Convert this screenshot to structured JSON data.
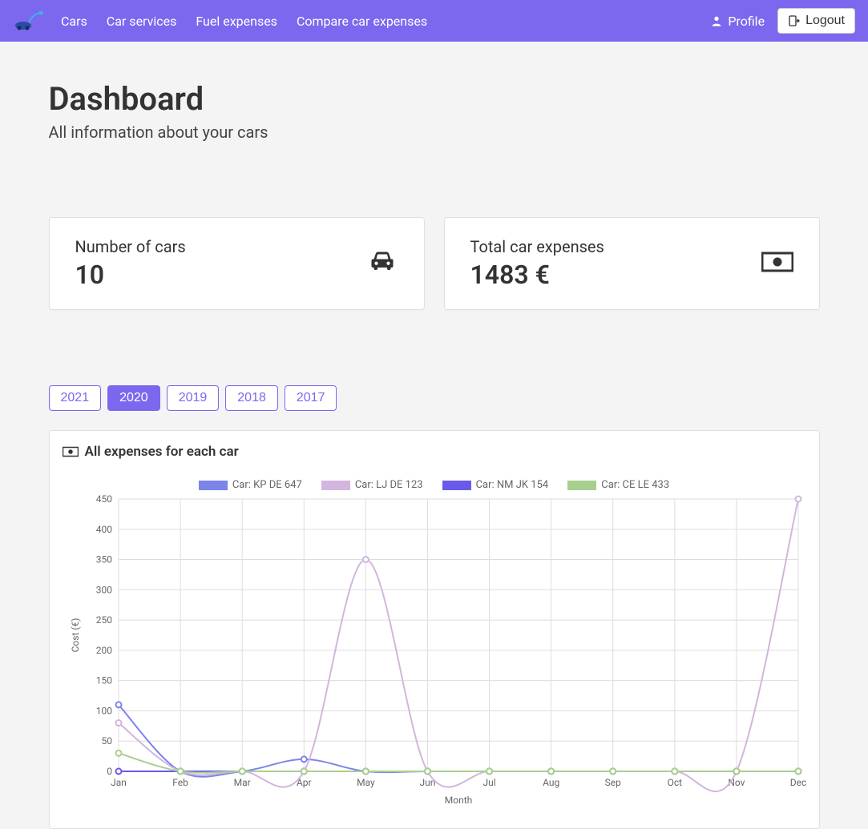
{
  "nav": {
    "links": [
      "Cars",
      "Car services",
      "Fuel expenses",
      "Compare car expenses"
    ],
    "profile": "Profile",
    "logout": "Logout"
  },
  "header": {
    "title": "Dashboard",
    "subtitle": "All information about your cars"
  },
  "cards": {
    "num_cars": {
      "label": "Number of cars",
      "value": "10"
    },
    "total_expenses": {
      "label": "Total car expenses",
      "value": "1483 €"
    }
  },
  "years": [
    "2021",
    "2020",
    "2019",
    "2018",
    "2017"
  ],
  "active_year": "2020",
  "chart_title": "All expenses for each car",
  "chart_data": {
    "type": "line",
    "title": "All expenses for each car",
    "xlabel": "Month",
    "ylabel": "Cost (€)",
    "categories": [
      "Jan",
      "Feb",
      "Mar",
      "Apr",
      "May",
      "Jun",
      "Jul",
      "Aug",
      "Sep",
      "Oct",
      "Nov",
      "Dec"
    ],
    "ylim": [
      0,
      450
    ],
    "yticks": [
      0,
      50,
      100,
      150,
      200,
      250,
      300,
      350,
      400,
      450
    ],
    "series": [
      {
        "name": "Car: KP DE 647",
        "color": "#7b85e9",
        "values": [
          110,
          0,
          0,
          20,
          0,
          0,
          0,
          0,
          0,
          0,
          0,
          0
        ]
      },
      {
        "name": "Car: LJ DE 123",
        "color": "#d3b5de",
        "values": [
          80,
          0,
          0,
          0,
          350,
          0,
          0,
          0,
          0,
          0,
          0,
          450
        ]
      },
      {
        "name": "Car: NM JK 154",
        "color": "#6a5ae9",
        "values": [
          0,
          0,
          0,
          0,
          0,
          0,
          0,
          0,
          0,
          0,
          0,
          0
        ]
      },
      {
        "name": "Car: CE LE 433",
        "color": "#a9cf8f",
        "values": [
          30,
          0,
          0,
          0,
          0,
          0,
          0,
          0,
          0,
          0,
          0,
          0
        ]
      }
    ]
  }
}
